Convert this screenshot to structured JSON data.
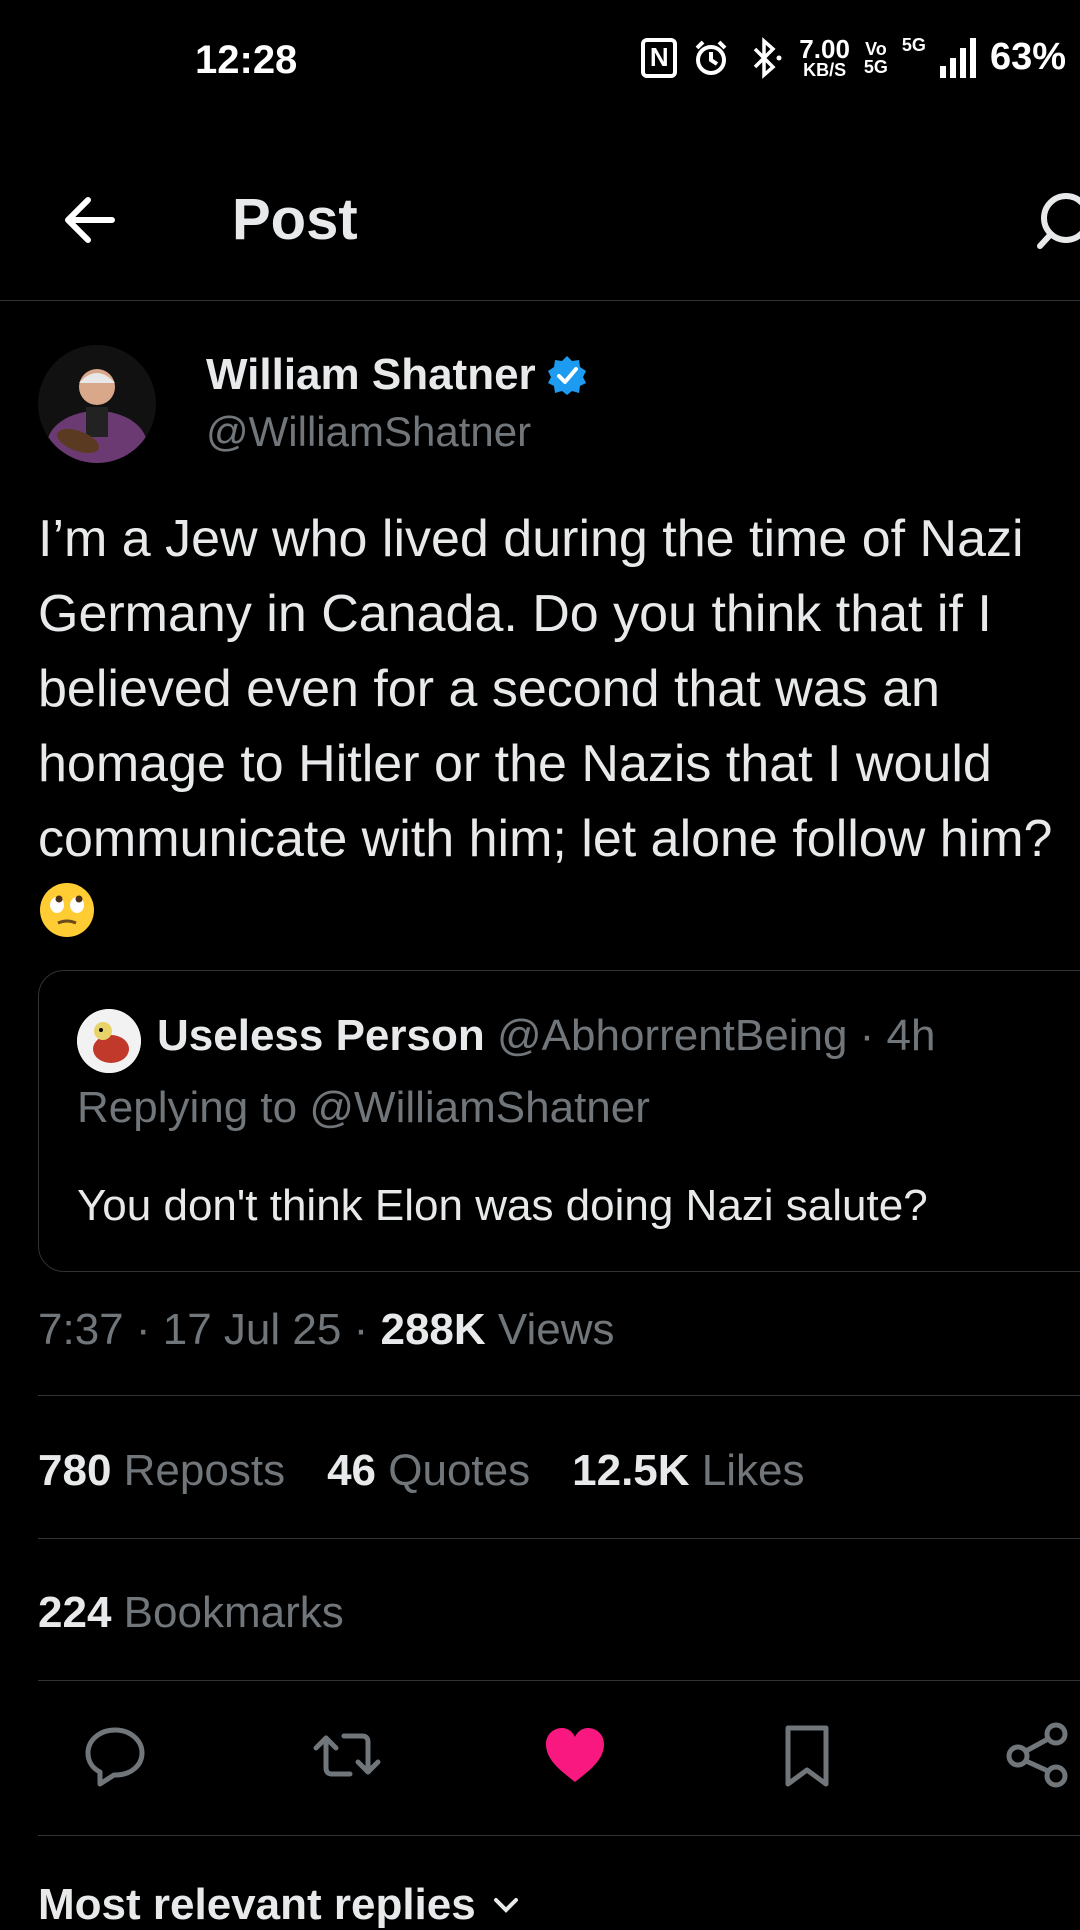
{
  "status_bar": {
    "time": "12:28",
    "nfc": "N",
    "speed_value": "7.00",
    "speed_unit": "KB/S",
    "volte": "Vo",
    "volte_sub": "5G",
    "network": "5G",
    "battery": "63%"
  },
  "header": {
    "title": "Post"
  },
  "tweet": {
    "author_name": "William Shatner",
    "author_handle": "@WilliamShatner",
    "text": "I’m a Jew who lived during the time of Nazi Germany in Canada. Do you think that if I believed even for a second that was an homage to Hitler or the Nazis that I would communicate with him; let alone follow him?",
    "emoji": "face-with-rolling-eyes",
    "time": "7:37",
    "date": "17 Jul 25",
    "views_count": "288K",
    "views_label": "Views"
  },
  "quoted": {
    "name": "Useless Person",
    "handle": "@AbhorrentBeing",
    "age": "4h",
    "replying_prefix": "Replying to",
    "replying_to": "@WilliamShatner",
    "text": "You don't think Elon was doing Nazi salute?"
  },
  "stats": {
    "reposts_count": "780",
    "reposts_label": "Reposts",
    "quotes_count": "46",
    "quotes_label": "Quotes",
    "likes_count": "12.5K",
    "likes_label": "Likes",
    "bookmarks_count": "224",
    "bookmarks_label": "Bookmarks"
  },
  "colors": {
    "background": "#000000",
    "text": "#e7e9ea",
    "muted": "#71767b",
    "verified": "#1d9bf0",
    "like": "#f91880",
    "divider": "#2f3336"
  },
  "replies_filter": "Most relevant replies"
}
